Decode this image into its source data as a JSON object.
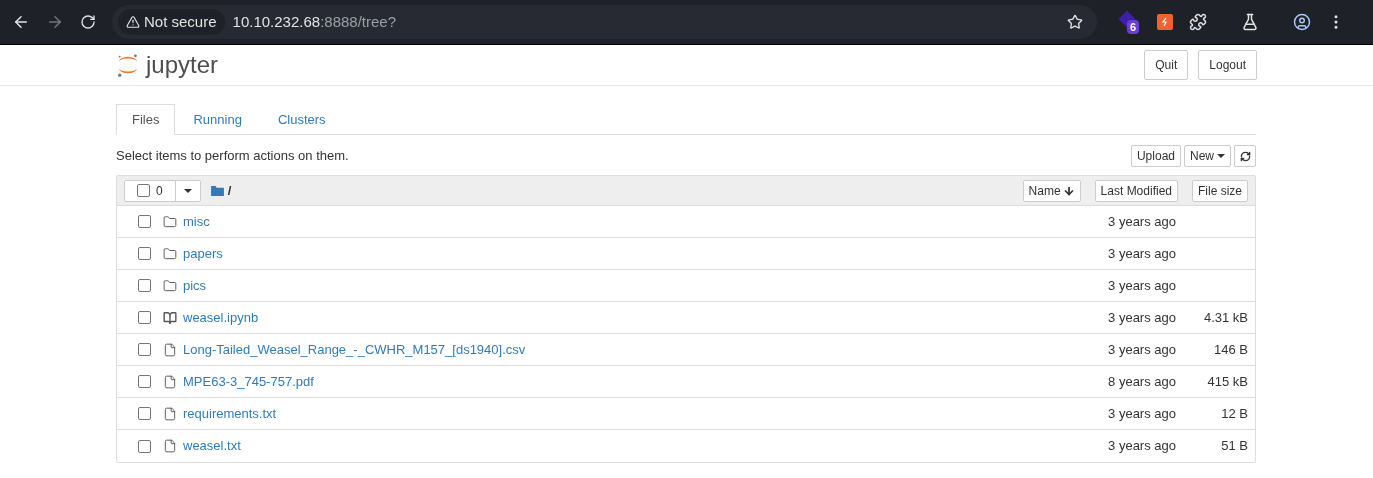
{
  "browser": {
    "security_label": "Not secure",
    "url_host": "10.10.232.68",
    "url_rest": ":8888/tree?",
    "extension_badge": "6"
  },
  "header": {
    "logo_text": "jupyter",
    "buttons": [
      "Quit",
      "Logout"
    ]
  },
  "tabs": [
    {
      "label": "Files",
      "selected": true
    },
    {
      "label": "Running",
      "selected": false
    },
    {
      "label": "Clusters",
      "selected": false
    }
  ],
  "toolbar": {
    "hint": "Select items to perform actions on them.",
    "buttons": [
      "Upload",
      "New"
    ]
  },
  "list_header": {
    "selected_count": "0",
    "path": "/",
    "sort_buttons": [
      "Name",
      "Last Modified",
      "File size"
    ]
  },
  "files": [
    {
      "kind": "folder",
      "name": "misc",
      "modified": "3 years ago",
      "checked": false
    },
    {
      "kind": "folder",
      "name": "papers",
      "modified": "3 years ago",
      "checked": false
    },
    {
      "kind": "folder",
      "name": "pics",
      "modified": "3 years ago",
      "checked": false
    },
    {
      "kind": "notebook",
      "name": "weasel.ipynb",
      "modified": "3 years ago",
      "size": "4.31 kB",
      "checked": false
    },
    {
      "kind": "file",
      "name": "Long-Tailed_Weasel_Range_-_CWHR_M157_[ds1940].csv",
      "modified": "3 years ago",
      "size": "146 B",
      "checked": false
    },
    {
      "kind": "file",
      "name": "MPE63-3_745-757.pdf",
      "modified": "8 years ago",
      "size": "415 kB",
      "checked": false
    },
    {
      "kind": "file",
      "name": "requirements.txt",
      "modified": "3 years ago",
      "size": "12 B",
      "checked": false
    },
    {
      "kind": "file",
      "name": "weasel.txt",
      "modified": "3 years ago",
      "size": "51 B",
      "checked": false
    }
  ]
}
